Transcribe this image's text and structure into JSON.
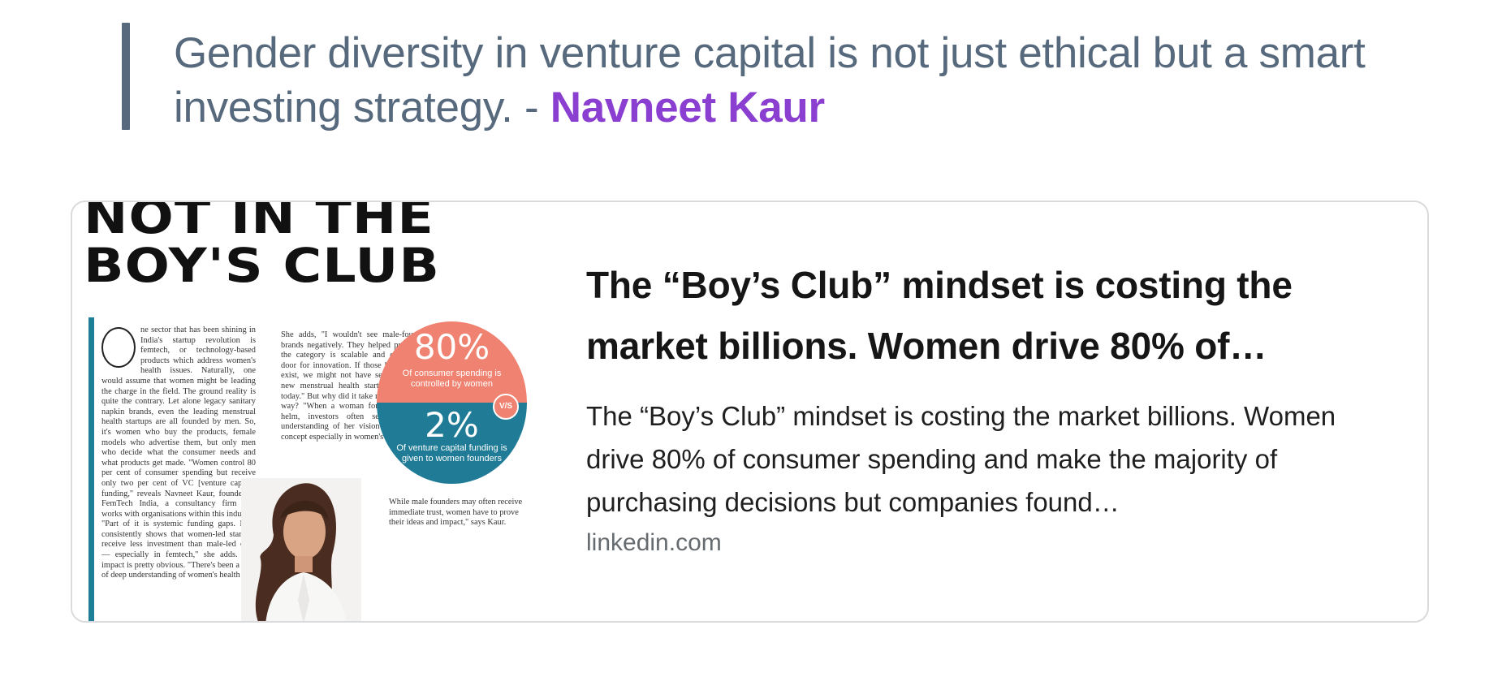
{
  "quote": {
    "text": "Gender diversity in venture capital is not just ethical but a smart investing strategy. - ",
    "author": "Navneet Kaur"
  },
  "link_card": {
    "thumbnail": {
      "headline_line1": "NOT IN THE",
      "headline_line2": "BOY'S CLUB",
      "column_a": "ne sector that has been shining in India's startup revolution is femtech, or technology-based products which address women's health issues. Naturally, one would assume that women might be leading the charge in the field. The ground reality is quite the contrary. Let alone legacy sanitary napkin brands, even the leading menstrual health startups are all founded by men. So, it's women who buy the products, female models who advertise them, but only men who decide what the consumer needs and what products get made. \"Women control 80 per cent of consumer spending but receive only two per cent of VC [venture capital] funding,\" reveals Navneet Kaur, founder of FemTech India, a consultancy firm that works with organisations within this industry. \"Part of it is systemic funding gaps. Data consistently shows that women-led startups receive less investment than male-led ones — especially in femtech,\" she adds. The impact is pretty obvious. \"There's been a lack of deep understanding of women's health",
      "column_b": "She adds, \"I wouldn't see male-founded brands negatively. They helped prove that the category is scalable and opened the door for innovation. If those brands didn't exist, we might not have seen the 10–15 new menstrual health startups that exist today.\" But why did it take men to pave the way? \"When a woman founder is at the helm, investors often seek a deeper understanding of her vision and proof of concept especially in women's health.",
      "column_c": "While male founders may often receive immediate trust, women have to prove their ideas and impact,\" says Kaur.",
      "stat_top_value": "80%",
      "stat_top_caption": "Of consumer spending is controlled by women",
      "stat_vs": "V/S",
      "stat_bottom_value": "2%",
      "stat_bottom_caption": "Of venture capital funding is given to women founders",
      "portrait_icon": "woman-portrait-photo"
    },
    "title": "The “Boy’s Club” mindset is costing the market billions. Women drive 80% of…",
    "description": "The “Boy’s Club” mindset is costing the market billions. Women drive 80% of consumer spending and make the majority of purchasing decisions but companies found…",
    "domain": "linkedin.com"
  },
  "colors": {
    "quote_bar": "#57697d",
    "quote_text": "#57697d",
    "author_link": "#8a3fd1",
    "stat_top": "#ef8270",
    "stat_bottom": "#1f7b96",
    "teal_rule": "#1d7f97"
  }
}
